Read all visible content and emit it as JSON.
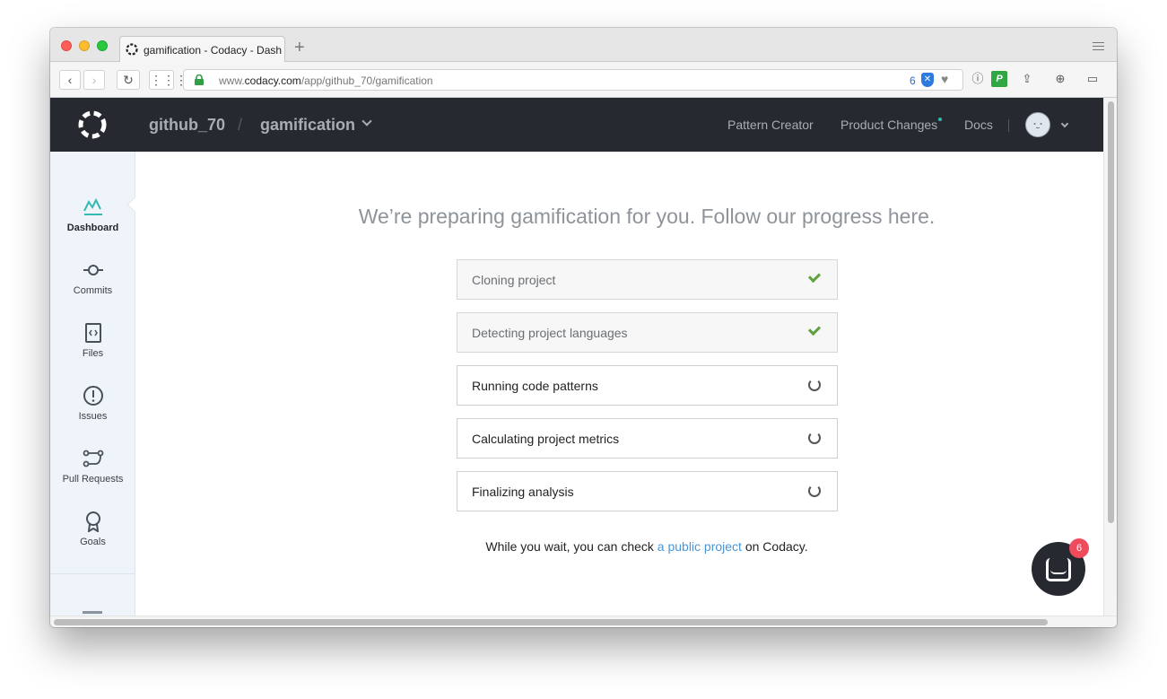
{
  "browser": {
    "tab_title": "gamification - Codacy - Dashboard",
    "new_tab_label": "+",
    "url_prefix": "www.",
    "url_domain": "codacy.com",
    "url_path": "/app/github_70/gamification",
    "extension_count": "6",
    "back_icon": "chevron-left-icon",
    "forward_icon": "chevron-right-icon",
    "reload_icon": "reload-icon",
    "apps_icon": "apps-grid-icon"
  },
  "header": {
    "organization": "github_70",
    "separator": "/",
    "project": "gamification",
    "links": [
      "Pattern Creator",
      "Product Changes",
      "Docs"
    ],
    "notification_dot_color": "#36b8b3"
  },
  "sidebar": {
    "items": [
      {
        "label": "Dashboard",
        "icon": "dashboard-chart-icon",
        "active": true
      },
      {
        "label": "Commits",
        "icon": "commit-icon",
        "active": false
      },
      {
        "label": "Files",
        "icon": "file-code-icon",
        "active": false
      },
      {
        "label": "Issues",
        "icon": "alert-circle-icon",
        "active": false
      },
      {
        "label": "Pull Requests",
        "icon": "pull-request-icon",
        "active": false
      },
      {
        "label": "Goals",
        "icon": "award-icon",
        "active": false
      }
    ]
  },
  "main": {
    "headline": "We’re preparing gamification for you. Follow our progress here.",
    "steps": [
      {
        "label": "Cloning project",
        "status": "done"
      },
      {
        "label": "Detecting project languages",
        "status": "done"
      },
      {
        "label": "Running code patterns",
        "status": "pending"
      },
      {
        "label": "Calculating project metrics",
        "status": "pending"
      },
      {
        "label": "Finalizing analysis",
        "status": "pending"
      }
    ],
    "wait_prefix": "While you wait, you can check ",
    "wait_link": "a public project",
    "wait_suffix": " on Codacy."
  },
  "chat": {
    "badge_count": "6",
    "icon": "chat-bubble-icon"
  },
  "colors": {
    "header_bg": "#262a30",
    "sidebar_bg": "#eef4fa",
    "check_green": "#5da23a",
    "link_blue": "#4a95d6",
    "badge_red": "#ef4b5d"
  }
}
